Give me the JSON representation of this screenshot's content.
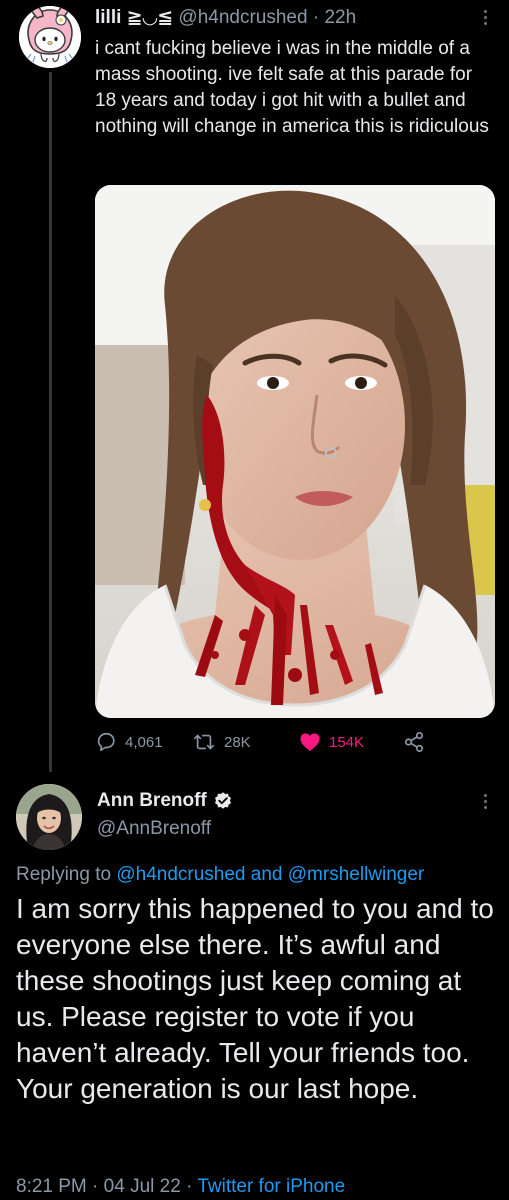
{
  "tweet1": {
    "display_name": "lilli ≧◡≦",
    "handle": "@h4ndcrushed",
    "separator": "·",
    "time": "22h",
    "text": "i cant fucking believe i was in the middle of a mass shooting. ive felt safe at this parade for 18 years and today i got hit with a bullet and nothing will change in america this is ridiculous",
    "replies": "4,061",
    "retweets": "28K",
    "likes": "154K",
    "liked": true,
    "icons": {
      "avatar": "my-melody-avatar",
      "more": "more-vertical-icon",
      "reply": "reply-icon",
      "retweet": "retweet-icon",
      "like": "heart-icon",
      "share": "share-icon"
    }
  },
  "tweet2": {
    "display_name": "Ann Brenoff",
    "handle": "@AnnBrenoff",
    "verified": true,
    "replying_prefix": "Replying to",
    "replying_user1": "@h4ndcrushed",
    "replying_and": "and",
    "replying_user2": "@mrshellwinger",
    "text": "I am sorry this happened to you and to everyone else there. It’s awful and these shootings just keep coming at us. Please register to vote if you haven’t already. Tell your friends too. Your generation is our last hope.",
    "time": "8:21 PM",
    "separator": "·",
    "date": "04 Jul 22",
    "source": "Twitter for iPhone"
  },
  "colors": {
    "background": "#000000",
    "text": "#e7e9ea",
    "secondary": "#8b98a5",
    "link": "#1d9bf0",
    "like": "#f91880",
    "verified": "#e7e9ea"
  }
}
